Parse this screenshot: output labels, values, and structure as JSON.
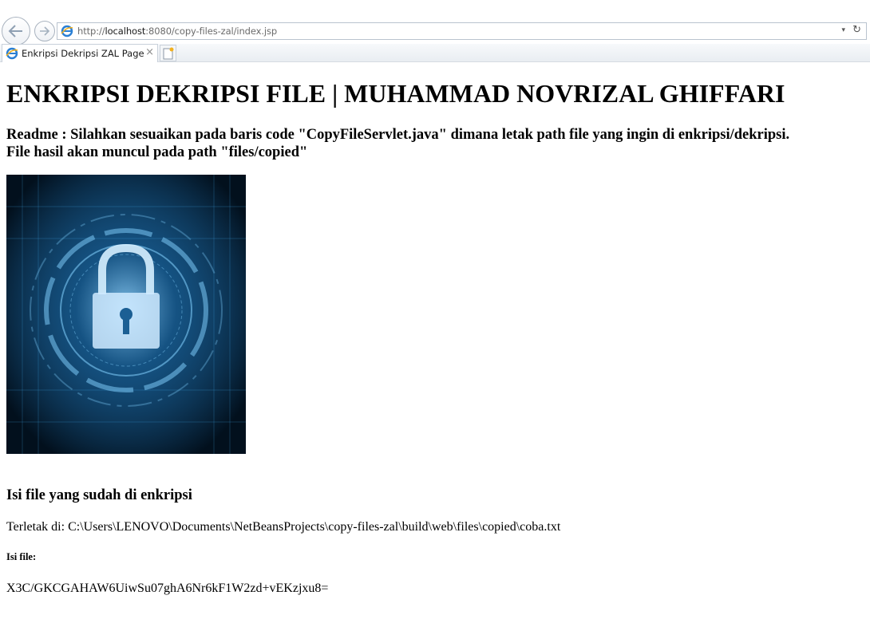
{
  "browser": {
    "url_prefix": "http://",
    "url_host": "localhost",
    "url_rest": ":8080/copy-files-zal/index.jsp",
    "tab_title": "Enkripsi Dekripsi ZAL Page",
    "tab_close": "×",
    "dropdown": "▾",
    "refresh": "↻"
  },
  "page": {
    "title": "ENKRIPSI DEKRIPSI FILE | MUHAMMAD NOVRIZAL GHIFFARI",
    "readme_line1": "Readme : Silahkan sesuaikan pada baris code \"CopyFileServlet.java\" dimana letak path file yang ingin di enkripsi/dekripsi.",
    "readme_line2": "File hasil akan muncul pada path \"files/copied\"",
    "encrypted_heading": "Isi file yang sudah di enkripsi",
    "location": "Terletak di: C:\\Users\\LENOVO\\Documents\\NetBeansProjects\\copy-files-zal\\build\\web\\files\\copied\\coba.txt",
    "content_label": "Isi file:",
    "cipher_text": "X3C/GKCGAHAW6UiwSu07ghA6Nr6kF1W2zd+vEKzjxu8="
  },
  "hero_image": {
    "icon": "padlock-icon",
    "bg_color": "#02101d",
    "accent_color": "#3fa9e6"
  }
}
